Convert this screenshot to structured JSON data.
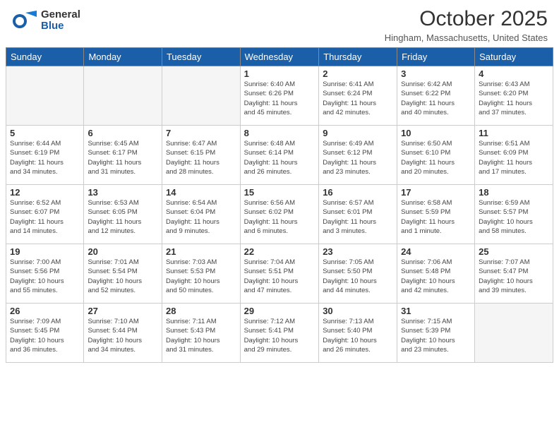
{
  "header": {
    "logo": {
      "general": "General",
      "blue": "Blue"
    },
    "title": "October 2025",
    "location": "Hingham, Massachusetts, United States"
  },
  "days_of_week": [
    "Sunday",
    "Monday",
    "Tuesday",
    "Wednesday",
    "Thursday",
    "Friday",
    "Saturday"
  ],
  "weeks": [
    [
      {
        "day": "",
        "info": ""
      },
      {
        "day": "",
        "info": ""
      },
      {
        "day": "",
        "info": ""
      },
      {
        "day": "1",
        "info": "Sunrise: 6:40 AM\nSunset: 6:26 PM\nDaylight: 11 hours\nand 45 minutes."
      },
      {
        "day": "2",
        "info": "Sunrise: 6:41 AM\nSunset: 6:24 PM\nDaylight: 11 hours\nand 42 minutes."
      },
      {
        "day": "3",
        "info": "Sunrise: 6:42 AM\nSunset: 6:22 PM\nDaylight: 11 hours\nand 40 minutes."
      },
      {
        "day": "4",
        "info": "Sunrise: 6:43 AM\nSunset: 6:20 PM\nDaylight: 11 hours\nand 37 minutes."
      }
    ],
    [
      {
        "day": "5",
        "info": "Sunrise: 6:44 AM\nSunset: 6:19 PM\nDaylight: 11 hours\nand 34 minutes."
      },
      {
        "day": "6",
        "info": "Sunrise: 6:45 AM\nSunset: 6:17 PM\nDaylight: 11 hours\nand 31 minutes."
      },
      {
        "day": "7",
        "info": "Sunrise: 6:47 AM\nSunset: 6:15 PM\nDaylight: 11 hours\nand 28 minutes."
      },
      {
        "day": "8",
        "info": "Sunrise: 6:48 AM\nSunset: 6:14 PM\nDaylight: 11 hours\nand 26 minutes."
      },
      {
        "day": "9",
        "info": "Sunrise: 6:49 AM\nSunset: 6:12 PM\nDaylight: 11 hours\nand 23 minutes."
      },
      {
        "day": "10",
        "info": "Sunrise: 6:50 AM\nSunset: 6:10 PM\nDaylight: 11 hours\nand 20 minutes."
      },
      {
        "day": "11",
        "info": "Sunrise: 6:51 AM\nSunset: 6:09 PM\nDaylight: 11 hours\nand 17 minutes."
      }
    ],
    [
      {
        "day": "12",
        "info": "Sunrise: 6:52 AM\nSunset: 6:07 PM\nDaylight: 11 hours\nand 14 minutes."
      },
      {
        "day": "13",
        "info": "Sunrise: 6:53 AM\nSunset: 6:05 PM\nDaylight: 11 hours\nand 12 minutes."
      },
      {
        "day": "14",
        "info": "Sunrise: 6:54 AM\nSunset: 6:04 PM\nDaylight: 11 hours\nand 9 minutes."
      },
      {
        "day": "15",
        "info": "Sunrise: 6:56 AM\nSunset: 6:02 PM\nDaylight: 11 hours\nand 6 minutes."
      },
      {
        "day": "16",
        "info": "Sunrise: 6:57 AM\nSunset: 6:01 PM\nDaylight: 11 hours\nand 3 minutes."
      },
      {
        "day": "17",
        "info": "Sunrise: 6:58 AM\nSunset: 5:59 PM\nDaylight: 11 hours\nand 1 minute."
      },
      {
        "day": "18",
        "info": "Sunrise: 6:59 AM\nSunset: 5:57 PM\nDaylight: 10 hours\nand 58 minutes."
      }
    ],
    [
      {
        "day": "19",
        "info": "Sunrise: 7:00 AM\nSunset: 5:56 PM\nDaylight: 10 hours\nand 55 minutes."
      },
      {
        "day": "20",
        "info": "Sunrise: 7:01 AM\nSunset: 5:54 PM\nDaylight: 10 hours\nand 52 minutes."
      },
      {
        "day": "21",
        "info": "Sunrise: 7:03 AM\nSunset: 5:53 PM\nDaylight: 10 hours\nand 50 minutes."
      },
      {
        "day": "22",
        "info": "Sunrise: 7:04 AM\nSunset: 5:51 PM\nDaylight: 10 hours\nand 47 minutes."
      },
      {
        "day": "23",
        "info": "Sunrise: 7:05 AM\nSunset: 5:50 PM\nDaylight: 10 hours\nand 44 minutes."
      },
      {
        "day": "24",
        "info": "Sunrise: 7:06 AM\nSunset: 5:48 PM\nDaylight: 10 hours\nand 42 minutes."
      },
      {
        "day": "25",
        "info": "Sunrise: 7:07 AM\nSunset: 5:47 PM\nDaylight: 10 hours\nand 39 minutes."
      }
    ],
    [
      {
        "day": "26",
        "info": "Sunrise: 7:09 AM\nSunset: 5:45 PM\nDaylight: 10 hours\nand 36 minutes."
      },
      {
        "day": "27",
        "info": "Sunrise: 7:10 AM\nSunset: 5:44 PM\nDaylight: 10 hours\nand 34 minutes."
      },
      {
        "day": "28",
        "info": "Sunrise: 7:11 AM\nSunset: 5:43 PM\nDaylight: 10 hours\nand 31 minutes."
      },
      {
        "day": "29",
        "info": "Sunrise: 7:12 AM\nSunset: 5:41 PM\nDaylight: 10 hours\nand 29 minutes."
      },
      {
        "day": "30",
        "info": "Sunrise: 7:13 AM\nSunset: 5:40 PM\nDaylight: 10 hours\nand 26 minutes."
      },
      {
        "day": "31",
        "info": "Sunrise: 7:15 AM\nSunset: 5:39 PM\nDaylight: 10 hours\nand 23 minutes."
      },
      {
        "day": "",
        "info": ""
      }
    ]
  ]
}
